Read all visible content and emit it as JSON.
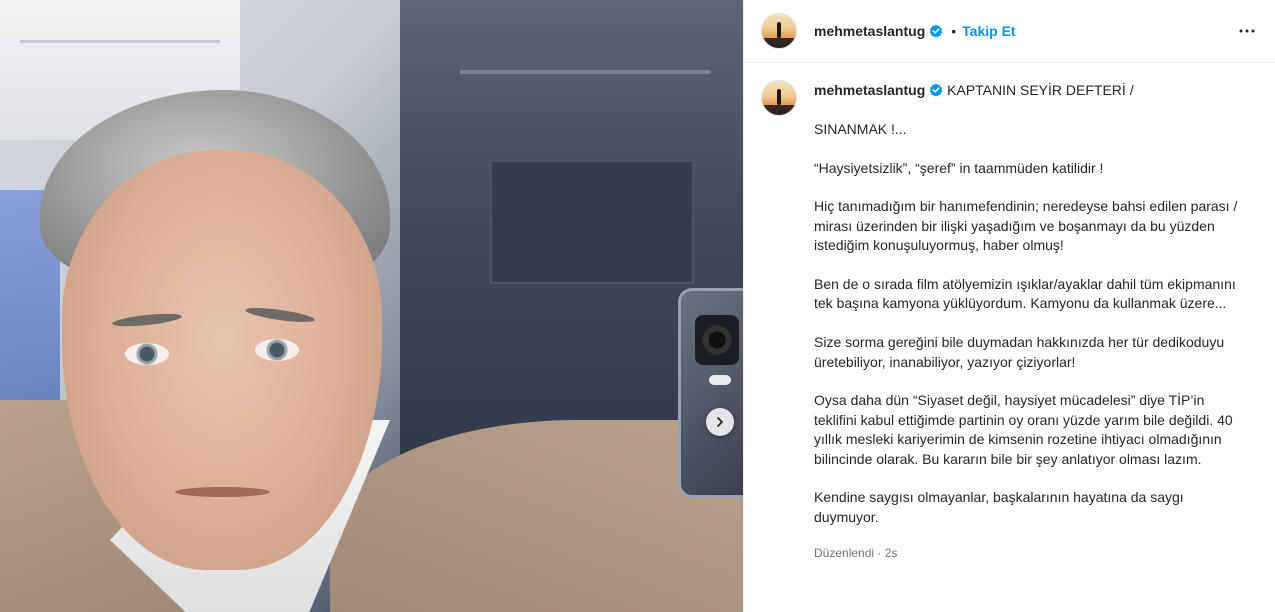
{
  "post": {
    "username": "mehmetaslantug",
    "follow_label": "Takip Et",
    "separator": "•"
  },
  "caption": {
    "username": "mehmetaslantug",
    "title": "KAPTANIN SEYİR DEFTERİ /",
    "paragraphs": [
      "SINANMAK !...",
      "“Haysiyetsizlik”, “şeref” in taammüden katilidir !",
      "Hiç tanımadığım bir hanımefendinin; neredeyse bahsi edilen parası / mirası üzerinden bir ilişki yaşadığım ve boşanmayı da bu yüzden istediğim konuşuluyormuş, haber olmuş!",
      "Ben de o sırada film atölyemizin ışıklar/ayaklar dahil tüm ekipmanını tek başına kamyona yüklüyordum. Kamyonu da kullanmak üzere...",
      "Size sorma gereğini bile duymadan hakkınızda her tür dedikoduyu üretebiliyor, inanabiliyor, yazıyor çiziyorlar!",
      "Oysa daha dün “Siyaset değil, haysiyet mücadelesi” diye TİP’in teklifini kabul ettiğimde partinin oy oranı yüzde yarım bile değildi. 40 yıllık mesleki kariyerimin de kimsenin rozetine ihtiyacı olmadığının bilincinde olarak. Bu kararın bile bir şey anlatıyor olması lazım.",
      "Kendine saygısı olmayanlar, başkalarının hayatına da saygı duymuyor."
    ],
    "edited_label": "Düzenlendi",
    "meta_separator": "·",
    "time": "2s"
  },
  "colors": {
    "follow": "#0095f6",
    "verified": "#0095f6",
    "text": "#262626",
    "muted": "#737373"
  },
  "icons": {
    "verified": "verified-badge-icon",
    "more": "more-options-icon",
    "next": "chevron-right-icon"
  }
}
